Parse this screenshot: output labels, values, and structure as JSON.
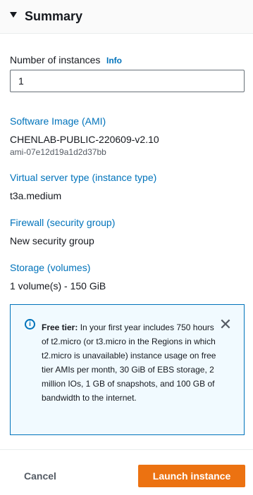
{
  "summary": {
    "title": "Summary",
    "caret_icon": "caret-down-icon"
  },
  "instances": {
    "label": "Number of instances",
    "info": "Info",
    "value": "1"
  },
  "ami": {
    "label": "Software Image (AMI)",
    "name": "CHENLAB-PUBLIC-220609-v2.10",
    "id": "ami-07e12d19a1d2d37bb"
  },
  "instance_type": {
    "label": "Virtual server type (instance type)",
    "value": "t3a.medium"
  },
  "firewall": {
    "label": "Firewall (security group)",
    "value": "New security group"
  },
  "storage": {
    "label": "Storage (volumes)",
    "value": "1 volume(s) - 150 GiB"
  },
  "free_tier": {
    "icon": "info-icon",
    "title": "Free tier:",
    "text": "In your first year includes 750 hours of t2.micro (or t3.micro in the Regions in which t2.micro is unavailable) instance usage on free tier AMIs per month, 30 GiB of EBS storage, 2 million IOs, 1 GB of snapshots, and 100 GB of bandwidth to the internet.",
    "close_icon": "close-icon"
  },
  "actions": {
    "cancel": "Cancel",
    "launch": "Launch instance"
  },
  "colors": {
    "link": "#0073bb",
    "primary": "#ec7211",
    "alert_bg": "#f1faff"
  }
}
